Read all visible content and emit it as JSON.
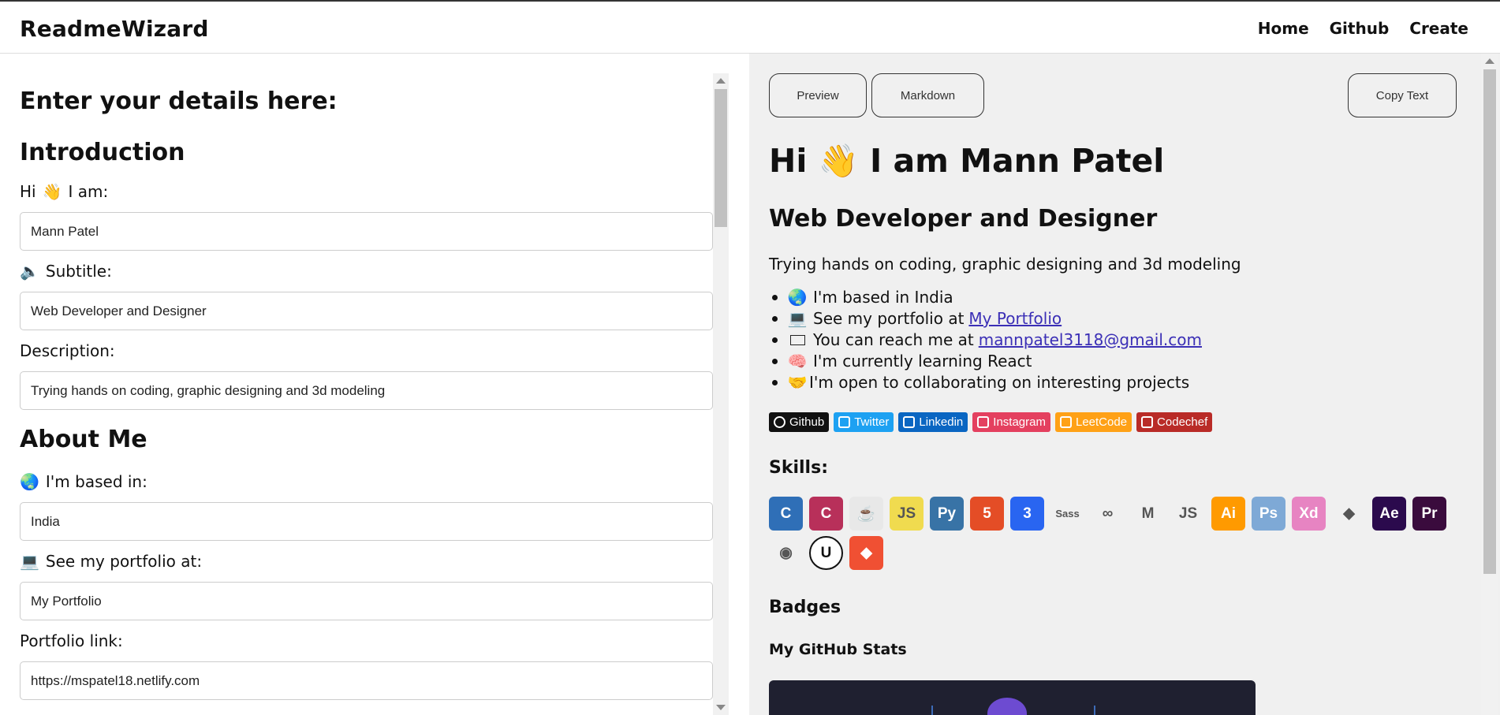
{
  "app": {
    "brand": "ReadmeWizard"
  },
  "nav": {
    "home": "Home",
    "github": "Github",
    "create": "Create"
  },
  "form": {
    "heading": "Enter your details here:",
    "intro_heading": "Introduction",
    "name_label": "I am:",
    "name_prefix": "Hi",
    "name_value": "Mann Patel",
    "subtitle_label": "Subtitle:",
    "subtitle_value": "Web Developer and Designer",
    "description_label": "Description:",
    "description_value": "Trying hands on coding, graphic designing and 3d modeling",
    "about_heading": "About Me",
    "based_label": "I'm based in:",
    "based_value": "India",
    "portfolio_label": "See my portfolio at:",
    "portfolio_value": "My Portfolio",
    "portfolio_link_label": "Portfolio link:",
    "portfolio_link_value": "https://mspatel18.netlify.com"
  },
  "toolbar": {
    "preview": "Preview",
    "markdown": "Markdown",
    "copy": "Copy Text"
  },
  "preview": {
    "title": "Hi 👋 I am Mann Patel",
    "subtitle": "Web Developer and Designer",
    "description": "Trying hands on coding, graphic designing and 3d modeling",
    "list": [
      {
        "text": "I'm based in India",
        "link": ""
      },
      {
        "text": "See my portfolio at",
        "link": "My Portfolio"
      },
      {
        "text": "You can reach me at",
        "link": "mannpatel3118@gmail.com"
      },
      {
        "text": "I'm currently learning React",
        "link": ""
      },
      {
        "text": "I'm open to collaborating on interesting projects",
        "link": ""
      }
    ],
    "socials": [
      {
        "label": "Github",
        "color": "#111111"
      },
      {
        "label": "Twitter",
        "color": "#1DA1F2"
      },
      {
        "label": "Linkedin",
        "color": "#0A66C2"
      },
      {
        "label": "Instagram",
        "color": "#E4405F"
      },
      {
        "label": "LeetCode",
        "color": "#FFA116"
      },
      {
        "label": "Codechef",
        "color": "#B92B27"
      }
    ],
    "skills_heading": "Skills:",
    "skills": [
      {
        "name": "c-icon",
        "glyph": "C",
        "bg": "#2f6fb7"
      },
      {
        "name": "cplusplus-icon",
        "glyph": "C",
        "bg": "#b8305a"
      },
      {
        "name": "java-icon",
        "glyph": "☕",
        "bg": "#e8e8e8"
      },
      {
        "name": "javascript-icon",
        "glyph": "JS",
        "bg": "#f0db4f"
      },
      {
        "name": "python-icon",
        "glyph": "Py",
        "bg": "#3873a6"
      },
      {
        "name": "html5-icon",
        "glyph": "5",
        "bg": "#e44d26"
      },
      {
        "name": "css3-icon",
        "glyph": "3",
        "bg": "#2965f1"
      },
      {
        "name": "sass-icon",
        "glyph": "Sass",
        "bg": "#f0f0f0"
      },
      {
        "name": "redux-icon",
        "glyph": "∞",
        "bg": "#f0f0f0"
      },
      {
        "name": "mui-icon",
        "glyph": "M",
        "bg": "#f0f0f0"
      },
      {
        "name": "nodejs-icon",
        "glyph": "JS",
        "bg": "#f0f0f0"
      },
      {
        "name": "illustrator-icon",
        "glyph": "Ai",
        "bg": "#ff9a00"
      },
      {
        "name": "photoshop-icon",
        "glyph": "Ps",
        "bg": "#7ea9d6"
      },
      {
        "name": "xd-icon",
        "glyph": "Xd",
        "bg": "#e784c2"
      },
      {
        "name": "figma-icon",
        "glyph": "◆",
        "bg": "#f0f0f0"
      },
      {
        "name": "aftereffects-icon",
        "glyph": "Ae",
        "bg": "#2b0a4d"
      },
      {
        "name": "premiere-icon",
        "glyph": "Pr",
        "bg": "#3a0b3d"
      },
      {
        "name": "blender-icon",
        "glyph": "◉",
        "bg": "#f0f0f0"
      },
      {
        "name": "unreal-icon",
        "glyph": "U",
        "bg": "#111111"
      },
      {
        "name": "git-icon",
        "glyph": "◆",
        "bg": "#f05033"
      }
    ],
    "badges_heading": "Badges",
    "stats_heading": "My GitHub Stats"
  }
}
